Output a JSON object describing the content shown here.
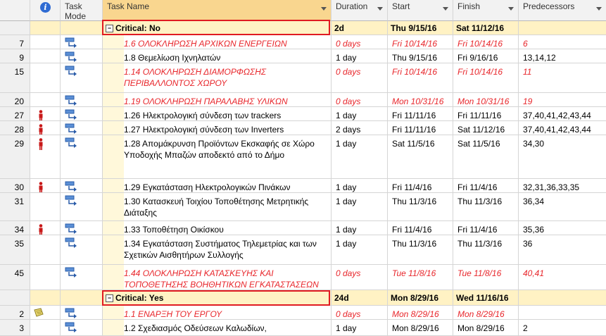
{
  "header": {
    "mode": "Task Mode",
    "name": "Task Name",
    "duration": "Duration",
    "start": "Start",
    "finish": "Finish",
    "predecessors": "Predecessors"
  },
  "groups": [
    {
      "label": "Critical: No",
      "duration": "2d",
      "start": "Thu 9/15/16",
      "finish": "Sat 11/12/16"
    },
    {
      "label": "Critical: Yes",
      "duration": "24d",
      "start": "Mon 8/29/16",
      "finish": "Wed 11/16/16"
    }
  ],
  "rows": [
    {
      "id": "7",
      "name": "1.6 ΟΛΟΚΛΗΡΩΣΗ ΑΡΧΙΚΩΝ ΕΝΕΡΓΕΙΩΝ",
      "duration": "0 days",
      "start": "Fri 10/14/16",
      "finish": "Fri 10/14/16",
      "pred": "6"
    },
    {
      "id": "9",
      "name": "1.8 Θεμελίωση Ιχνηλατών",
      "duration": "1 day",
      "start": "Thu 9/15/16",
      "finish": "Fri 9/16/16",
      "pred": "13,14,12"
    },
    {
      "id": "15",
      "name": "1.14 ΟΛΟΚΛΗΡΩΣΗ ΔΙΑΜΟΡΦΩΣΗΣ ΠΕΡΙΒΑΛΛΟΝΤΟΣ ΧΩΡΟΥ",
      "duration": "0 days",
      "start": "Fri 10/14/16",
      "finish": "Fri 10/14/16",
      "pred": "11"
    },
    {
      "id": "20",
      "name": "1.19 ΟΛΟΚΛΗΡΩΣΗ ΠΑΡΑΛΑΒΗΣ ΥΛΙΚΩΝ",
      "duration": "0 days",
      "start": "Mon 10/31/16",
      "finish": "Mon 10/31/16",
      "pred": "19"
    },
    {
      "id": "27",
      "name": "1.26 Ηλεκτρολογική σύνδεση των trackers",
      "duration": "1 day",
      "start": "Fri 11/11/16",
      "finish": "Fri 11/11/16",
      "pred": "37,40,41,42,43,44"
    },
    {
      "id": "28",
      "name": "1.27 Ηλεκτρολογική σύνδεση των Inverters",
      "duration": "2 days",
      "start": "Fri 11/11/16",
      "finish": "Sat 11/12/16",
      "pred": "37,40,41,42,43,44"
    },
    {
      "id": "29",
      "name": "1.28 Απομάκρυνση Προϊόντων Εκσκαφής σε Χώρο Υποδοχής Μπαζών αποδεκτό από το Δήμο",
      "duration": "1 day",
      "start": "Sat 11/5/16",
      "finish": "Sat 11/5/16",
      "pred": "34,30"
    },
    {
      "id": "30",
      "name": "1.29 Εγκατάσταση Ηλεκτρολογικών Πινάκων",
      "duration": "1 day",
      "start": "Fri 11/4/16",
      "finish": "Fri 11/4/16",
      "pred": "32,31,36,33,35"
    },
    {
      "id": "31",
      "name": "1.30 Κατασκευή Τοιχίου Τοποθέτησης Μετρητικής Διάταξης",
      "duration": "1 day",
      "start": "Thu 11/3/16",
      "finish": "Thu 11/3/16",
      "pred": "36,34"
    },
    {
      "id": "34",
      "name": "1.33 Τοποθέτηση Οικίσκου",
      "duration": "1 day",
      "start": "Fri 11/4/16",
      "finish": "Fri 11/4/16",
      "pred": "35,36"
    },
    {
      "id": "35",
      "name": "1.34 Εγκατάσταση Συστήματος Τηλεμετρίας και των Σχετικών Αισθητήρων Συλλογής",
      "duration": "1 day",
      "start": "Thu 11/3/16",
      "finish": "Thu 11/3/16",
      "pred": "36"
    },
    {
      "id": "45",
      "name": "1.44 ΟΛΟΚΛΗΡΩΣΗ ΚΑΤΑΣΚΕΥΗΣ ΚΑΙ ΤΟΠΟΘΕΤΗΣΗΣ ΒΟΗΘΗΤΙΚΩΝ ΕΓΚΑΤΑΣΤΑΣΕΩΝ",
      "duration": "0 days",
      "start": "Tue 11/8/16",
      "finish": "Tue 11/8/16",
      "pred": "40,41"
    },
    {
      "id": "2",
      "name": "1.1 ΕΝΑΡΞΗ ΤΟΥ ΕΡΓΟΥ",
      "duration": "0 days",
      "start": "Mon 8/29/16",
      "finish": "Mon 8/29/16",
      "pred": ""
    },
    {
      "id": "3",
      "name": "1.2 Σχεδιασμός Οδεύσεων Καλωδίων,",
      "duration": "1 day",
      "start": "Mon 8/29/16",
      "finish": "Mon 8/29/16",
      "pred": "2"
    }
  ],
  "colors": {
    "critical": "#e8262b",
    "group_bg": "#fff2c4",
    "header_sel": "#f9d68f",
    "outline": "#e01b22"
  }
}
